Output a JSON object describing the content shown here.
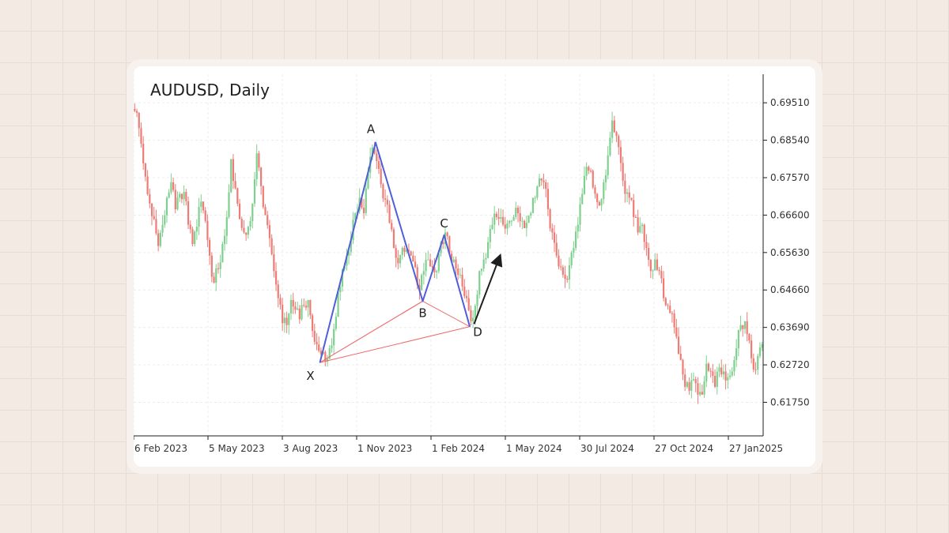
{
  "chart_data": {
    "type": "candlestick",
    "title": "AUDUSD, Daily",
    "y_ticks": [
      0.6175,
      0.6272,
      0.6369,
      0.6466,
      0.6563,
      0.666,
      0.6757,
      0.6854,
      0.6951
    ],
    "y_tick_labels": [
      "0.61750",
      "0.62720",
      "0.63690",
      "0.64660",
      "0.65630",
      "0.66600",
      "0.67570",
      "0.68540",
      "0.69510"
    ],
    "ylim": [
      0.6088,
      0.7025
    ],
    "x_tick_labels": [
      "6 Feb 2023",
      "5 May 2023",
      "3 Aug 2023",
      "1 Nov 2023",
      "1 Feb 2024",
      "1 May 2024",
      "30 Jul 2024",
      "27 Oct 2024",
      "27 Jan2025"
    ],
    "grid": true,
    "colors": {
      "up": "#7fd08e",
      "down": "#ee7b74",
      "pattern_legs": "#4f5fd8",
      "pattern_triangles": "#ee6a6a",
      "arrow": "#1e1e1e"
    },
    "series": [
      {
        "name": "AUDUSD close",
        "values": [
          0.6925,
          0.6845,
          0.676,
          0.669,
          0.665,
          0.658,
          0.6635,
          0.6705,
          0.6745,
          0.6675,
          0.6715,
          0.672,
          0.6635,
          0.6585,
          0.663,
          0.6695,
          0.6645,
          0.6555,
          0.6485,
          0.652,
          0.6585,
          0.6655,
          0.6805,
          0.673,
          0.665,
          0.6615,
          0.663,
          0.669,
          0.682,
          0.6735,
          0.666,
          0.66,
          0.6515,
          0.6445,
          0.638,
          0.6375,
          0.644,
          0.6415,
          0.639,
          0.6425,
          0.644,
          0.636,
          0.6325,
          0.63,
          0.628,
          0.6315,
          0.6365,
          0.646,
          0.652,
          0.6555,
          0.6595,
          0.6665,
          0.6705,
          0.6665,
          0.677,
          0.6835,
          0.68,
          0.674,
          0.67,
          0.664,
          0.6575,
          0.6535,
          0.6575,
          0.657,
          0.6555,
          0.6525,
          0.6465,
          0.6515,
          0.6545,
          0.6525,
          0.6515,
          0.659,
          0.6615,
          0.656,
          0.6545,
          0.6505,
          0.6475,
          0.6445,
          0.6385,
          0.6425,
          0.6515,
          0.6545,
          0.659,
          0.6635,
          0.6655,
          0.6655,
          0.6625,
          0.6645,
          0.6655,
          0.6665,
          0.6645,
          0.664,
          0.6665,
          0.6705,
          0.6755,
          0.6745,
          0.6675,
          0.6615,
          0.6555,
          0.6525,
          0.6495,
          0.653,
          0.6575,
          0.6635,
          0.6715,
          0.6785,
          0.6775,
          0.6715,
          0.6685,
          0.6745,
          0.6815,
          0.6905,
          0.6865,
          0.6795,
          0.6715,
          0.6705,
          0.6655,
          0.6615,
          0.6635,
          0.6575,
          0.6515,
          0.6545,
          0.6515,
          0.6445,
          0.6425,
          0.6405,
          0.6345,
          0.6285,
          0.6215,
          0.6205,
          0.6235,
          0.6195,
          0.6195,
          0.6275,
          0.6255,
          0.6215,
          0.6265,
          0.6255,
          0.624,
          0.6255,
          0.6315,
          0.6375,
          0.6385,
          0.6335,
          0.626,
          0.6295,
          0.6325
        ]
      }
    ],
    "harmonic_pattern": {
      "points": [
        {
          "label": "X",
          "index": 43,
          "price": 0.6278
        },
        {
          "label": "A",
          "index": 56,
          "price": 0.6848
        },
        {
          "label": "B",
          "index": 67,
          "price": 0.6437
        },
        {
          "label": "C",
          "index": 72,
          "price": 0.6608
        },
        {
          "label": "D",
          "index": 78,
          "price": 0.6371
        }
      ],
      "arrow": {
        "from_index": 79,
        "from_price": 0.6378,
        "to_index": 85,
        "to_price": 0.6553
      }
    }
  }
}
